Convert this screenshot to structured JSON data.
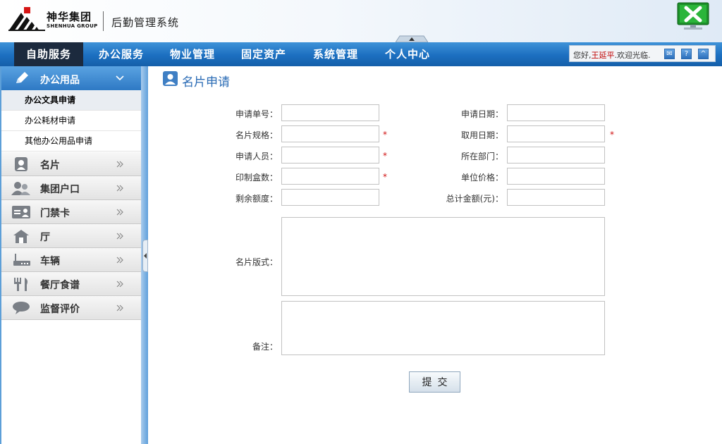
{
  "header": {
    "logo_cn": "神华集团",
    "logo_en": "SHENHUA GROUP",
    "system_title": "后勤管理系统"
  },
  "nav": {
    "items": [
      {
        "label": "自助服务",
        "active": true
      },
      {
        "label": "办公服务"
      },
      {
        "label": "物业管理"
      },
      {
        "label": "固定资产"
      },
      {
        "label": "系统管理"
      },
      {
        "label": "个人中心"
      }
    ],
    "welcome": {
      "prefix": "您好,",
      "user": "王延平",
      "suffix": ".欢迎光临."
    }
  },
  "sidebar": {
    "active_group": "办公用品",
    "sub_items": [
      "办公文具申请",
      "办公耗材申请",
      "其他办公用品申请"
    ],
    "current_sub": "办公文具申请",
    "items": [
      {
        "label": "名片",
        "icon": "person-card-icon"
      },
      {
        "label": "集团户口",
        "icon": "people-icon"
      },
      {
        "label": "门禁卡",
        "icon": "id-card-icon"
      },
      {
        "label": "厅",
        "icon": "house-icon"
      },
      {
        "label": "车辆",
        "icon": "vehicle-icon"
      },
      {
        "label": "餐厅食谱",
        "icon": "fork-knife-icon"
      },
      {
        "label": "监督评价",
        "icon": "speech-bubble-icon"
      }
    ]
  },
  "page": {
    "title": "名片申请"
  },
  "form": {
    "left": [
      {
        "label": "申请单号：",
        "required": false
      },
      {
        "label": "名片规格：",
        "required": true
      },
      {
        "label": "申请人员：",
        "required": true
      },
      {
        "label": "印制盒数：",
        "required": true
      },
      {
        "label": "剩余额度：",
        "required": false
      }
    ],
    "right": [
      {
        "label": "申请日期：",
        "required": false
      },
      {
        "label": "取用日期：",
        "required": true
      },
      {
        "label": "所在部门：",
        "required": false
      },
      {
        "label": "单位价格：",
        "required": false
      },
      {
        "label": "总计金额(元)：",
        "required": false
      }
    ],
    "format_label": "名片版式：",
    "remark_label": "备注：",
    "required_mark": "*",
    "submit_label": "提交"
  },
  "colors": {
    "nav_blue": "#1c6fc0",
    "nav_active": "#1c2a3e",
    "title_blue": "#2a6bb5",
    "required_red": "#d01010"
  }
}
